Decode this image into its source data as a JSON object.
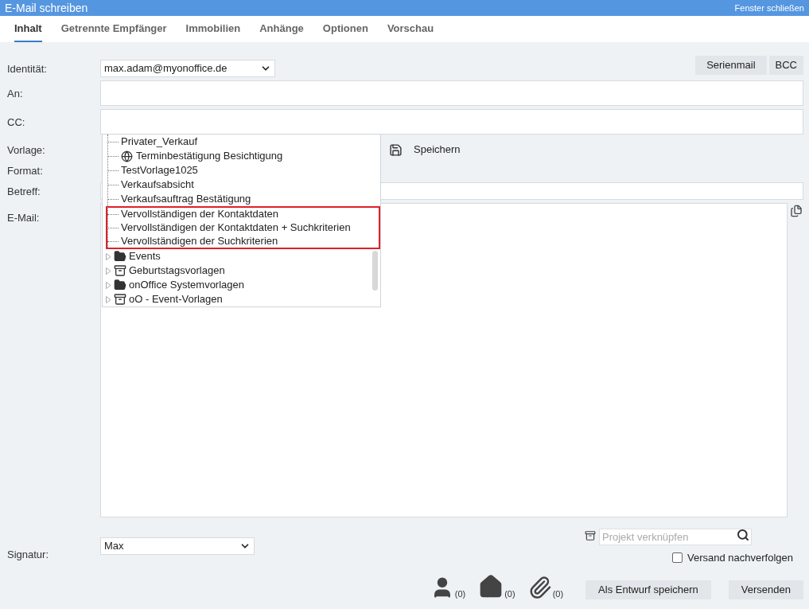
{
  "window": {
    "title": "E-Mail schreiben",
    "close_link": "Fenster schließen"
  },
  "tabs": [
    {
      "label": "Inhalt",
      "selected": true
    },
    {
      "label": "Getrennte Empfänger",
      "selected": false
    },
    {
      "label": "Immobilien",
      "selected": false
    },
    {
      "label": "Anhänge",
      "selected": false
    },
    {
      "label": "Optionen",
      "selected": false
    },
    {
      "label": "Vorschau",
      "selected": false
    }
  ],
  "identity": {
    "label": "Identität:",
    "value": "max.adam@myonoffice.de"
  },
  "top_buttons": [
    "Serienmail",
    "BCC"
  ],
  "to": {
    "label": "An:"
  },
  "cc": {
    "label": "CC:"
  },
  "template": {
    "label": "Vorlage:",
    "save": "Speichern"
  },
  "format": {
    "label": "Format:"
  },
  "subject": {
    "label": "Betreff:"
  },
  "email": {
    "label": "E-Mail:"
  },
  "template_tree": {
    "open_folder_items": [
      {
        "label": "Privater_Verkauf",
        "kind": "template",
        "highlighted": false
      },
      {
        "label": "Terminbestätigung Besichtigung",
        "kind": "web_template",
        "highlighted": false
      },
      {
        "label": "TestVorlage1025",
        "kind": "template",
        "highlighted": false
      },
      {
        "label": "Verkaufsabsicht",
        "kind": "template",
        "highlighted": false
      },
      {
        "label": "Verkaufsauftrag Bestätigung",
        "kind": "template",
        "highlighted": false
      },
      {
        "label": "Vervollständigen der Kontaktdaten",
        "kind": "template",
        "highlighted": true
      },
      {
        "label": "Vervollständigen der Kontaktdaten + Suchkriterien",
        "kind": "template",
        "highlighted": true
      },
      {
        "label": "Vervollständigen der Suchkriterien",
        "kind": "template",
        "highlighted": true
      }
    ],
    "folders": [
      {
        "label": "Events",
        "kind": "folder"
      },
      {
        "label": "Geburtstagsvorlagen",
        "kind": "shared_folder"
      },
      {
        "label": "onOffice Systemvorlagen",
        "kind": "folder"
      },
      {
        "label": "oO - Event-Vorlagen",
        "kind": "shared_folder"
      }
    ]
  },
  "signature": {
    "label": "Signatur:",
    "value": "Max"
  },
  "project": {
    "placeholder": "Projekt verknüpfen"
  },
  "tracking": {
    "label": "Versand nachverfolgen",
    "checked": false
  },
  "counters": [
    {
      "kind": "contacts",
      "count": "(0)"
    },
    {
      "kind": "properties",
      "count": "(0)"
    },
    {
      "kind": "attachments",
      "count": "(0)"
    }
  ],
  "bottom_buttons": [
    "Als Entwurf speichern",
    "Versenden"
  ]
}
